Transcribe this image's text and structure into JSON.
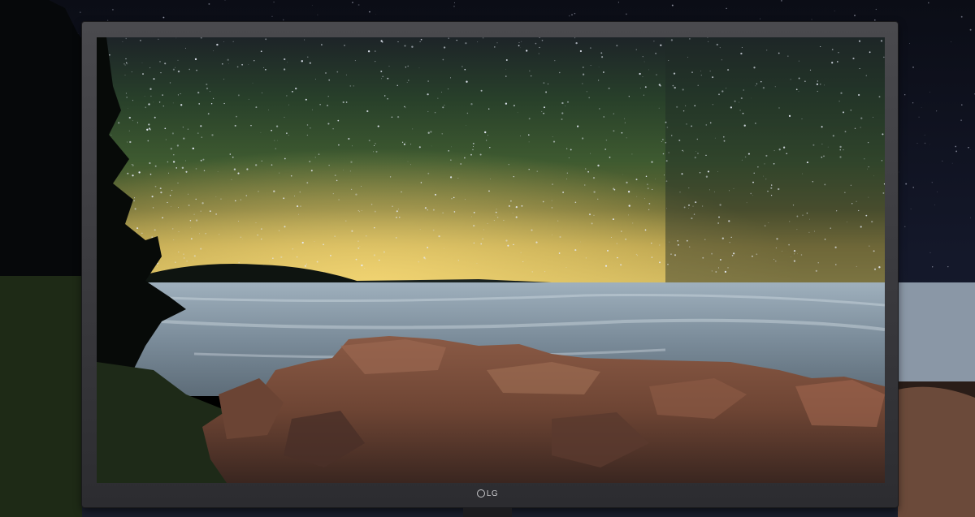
{
  "device": {
    "brand_label": "LG"
  },
  "scene": {
    "description_icon": "monitor-icon"
  }
}
